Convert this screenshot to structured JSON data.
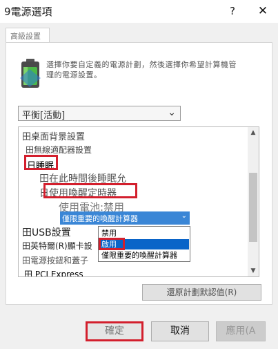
{
  "window": {
    "title": "9電源選項",
    "help_glyph": "?",
    "close_glyph": "✕"
  },
  "tab": {
    "label": "高級設置"
  },
  "description": {
    "line1": "選擇你要自定義的電源計劃，然後選擇你希望計算機管",
    "line2": "理的電源設置。"
  },
  "plan_select": {
    "value": "平衡[活動]"
  },
  "tree": {
    "items": [
      {
        "prefix": "田",
        "label": "桌面背景設置"
      },
      {
        "prefix": "田",
        "label": "無線適配器設置"
      },
      {
        "prefix": "日",
        "label": "睡眠"
      },
      {
        "prefix": "田",
        "label": "在此時間後睡眠允"
      },
      {
        "prefix": "日",
        "label": "使用喚醒定時器"
      },
      {
        "prefix": "",
        "label": "使用電池:禁用"
      },
      {
        "prefix": "田",
        "label": "USB設置"
      },
      {
        "prefix": "田",
        "label": "英特爾(R)顯卡設"
      },
      {
        "prefix": "田",
        "label": "電源按鈕和蓋子"
      },
      {
        "prefix": "田",
        "label": "PCI Express"
      }
    ],
    "scroll_up_glyph": "▲",
    "scroll_down_glyph": "▼"
  },
  "wake_combo": {
    "value": "僅限重要的喚醒計算器",
    "chevron": "⌄"
  },
  "wake_options": [
    "禁用",
    "啟用",
    "僅限重要的喚醒計算器"
  ],
  "selected_option": "啟用",
  "buttons": {
    "restore_defaults": "還原計劃默認值(R)",
    "ok": "確定",
    "cancel": "取消",
    "apply": "應用(A"
  },
  "colors": {
    "highlight": "#d31f2d",
    "selection": "#0a64c8",
    "combo_blue": "#3a86d6"
  },
  "icons": {
    "power_plan": "battery-icon",
    "dropdown": "chevron-down-icon"
  }
}
